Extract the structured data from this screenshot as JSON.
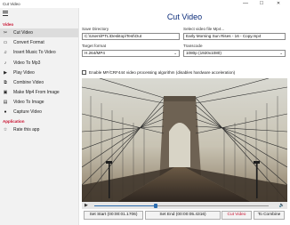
{
  "window": {
    "title": "Cut Video",
    "minimize": "—",
    "maximize": "☐",
    "close": "✕"
  },
  "sidebar": {
    "sections": [
      {
        "header": "Video",
        "items": [
          {
            "label": "Cut Video",
            "icon": "scissors-icon",
            "glyph": "✂",
            "active": true
          },
          {
            "label": "Convert Format",
            "icon": "convert-icon",
            "glyph": "▭"
          },
          {
            "label": "Insert Music To Video",
            "icon": "music-note-icon",
            "glyph": "♫"
          },
          {
            "label": "Video To Mp3",
            "icon": "audio-icon",
            "glyph": "♪"
          },
          {
            "label": "Play Video",
            "icon": "play-icon",
            "glyph": "▶"
          },
          {
            "label": "Combine Video",
            "icon": "combine-icon",
            "glyph": "⧉"
          },
          {
            "label": "Make Mp4 From Image",
            "icon": "image-icon",
            "glyph": "▣"
          },
          {
            "label": "Video To Image",
            "icon": "video-to-image-icon",
            "glyph": "▤"
          },
          {
            "label": "Capture Video",
            "icon": "camera-icon",
            "glyph": "●"
          }
        ]
      },
      {
        "header": "Application",
        "items": [
          {
            "label": "Rate this app",
            "icon": "star-icon",
            "glyph": "☆"
          }
        ]
      }
    ]
  },
  "main": {
    "title": "Cut Video",
    "save_directory": {
      "label": "Save Directory",
      "value": "C:\\Users\\PTL\\Desktop\\Test\\Out"
    },
    "select_file": {
      "label": "Select video file Mp4...",
      "value": "Early Morning Sun Rises - 16 - Copy.mp4"
    },
    "target_format": {
      "label": "Target format",
      "value": "H.264/MP4"
    },
    "transcode": {
      "label": "Transcode",
      "value": "1080p (1920x1080)"
    },
    "hw_checkbox": {
      "label": "Enable MF/CRF444 video processing algorithm (disables hardware acceleration)",
      "checked": false
    },
    "player": {
      "progress": 0.35
    },
    "buttons": {
      "set_start": "Set Start (00:00:01.1706)",
      "set_end": "Set End (00:00:05.4316)",
      "cut_video": "Cut Video",
      "to_combine": "To Combine"
    }
  },
  "colors": {
    "accent_red": "#c8102e",
    "title_blue": "#0b2c7a",
    "seek_blue": "#2b6cb0"
  }
}
